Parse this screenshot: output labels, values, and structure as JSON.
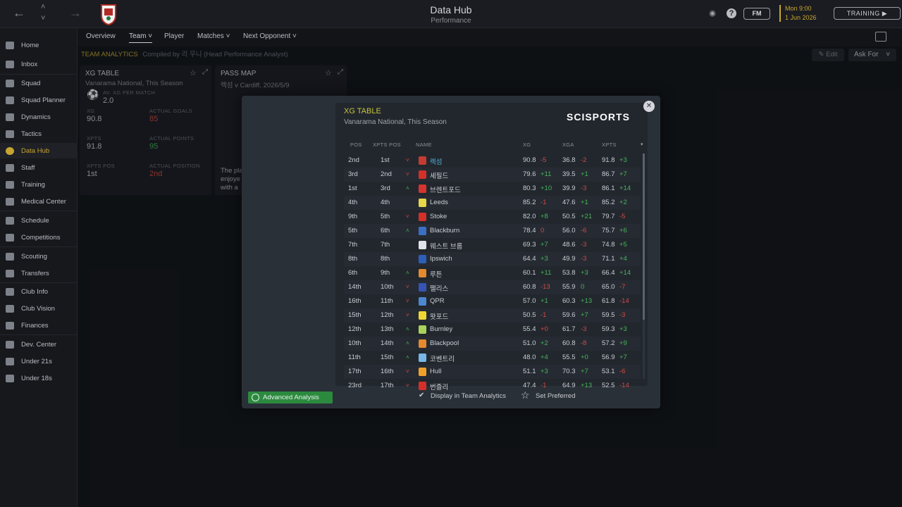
{
  "topbar": {
    "title": "Data Hub",
    "subtitle": "Performance",
    "fm_label": "FM",
    "date_line1": "Mon 9:00",
    "date_line2": "1 Jun 2026",
    "training_label": "TRAINING"
  },
  "sidebar": {
    "items": [
      {
        "label": "Home",
        "icon": "home-icon"
      },
      {
        "label": "Inbox",
        "icon": "inbox-icon"
      },
      {
        "label": "Squad",
        "icon": "shirt-icon"
      },
      {
        "label": "Squad Planner",
        "icon": "planner-icon"
      },
      {
        "label": "Dynamics",
        "icon": "dynamics-icon"
      },
      {
        "label": "Tactics",
        "icon": "tactics-icon"
      },
      {
        "label": "Data Hub",
        "icon": "data-hub-icon"
      },
      {
        "label": "Staff",
        "icon": "staff-icon"
      },
      {
        "label": "Training",
        "icon": "training-icon"
      },
      {
        "label": "Medical Center",
        "icon": "medical-icon"
      },
      {
        "label": "Schedule",
        "icon": "calendar-icon"
      },
      {
        "label": "Competitions",
        "icon": "trophy-icon"
      },
      {
        "label": "Scouting",
        "icon": "scouting-icon"
      },
      {
        "label": "Transfers",
        "icon": "transfers-icon"
      },
      {
        "label": "Club Info",
        "icon": "shield-icon"
      },
      {
        "label": "Club Vision",
        "icon": "vision-icon"
      },
      {
        "label": "Finances",
        "icon": "finances-icon"
      },
      {
        "label": "Dev. Center",
        "icon": "dev-center-icon"
      },
      {
        "label": "Under 21s",
        "icon": "under21-icon"
      },
      {
        "label": "Under 18s",
        "icon": "under18-icon"
      }
    ]
  },
  "subnav": {
    "tabs": [
      "Overview",
      "Team",
      "Player",
      "Matches",
      "Next Opponent"
    ]
  },
  "team_analytics": {
    "title": "TEAM ANALYTICS",
    "compiled_by": "Compiled by 리 무니 (Head Performance Analyst)",
    "edit_label": "Edit",
    "ask_for_label": "Ask For"
  },
  "xg_card": {
    "title": "XG TABLE",
    "subtitle": "Vanarama National, This Season",
    "av_label": "AV. XG PER MATCH",
    "av_value": "2.0",
    "xg_label": "XG",
    "xg_value": "90.8",
    "actual_goals_label": "ACTUAL GOALS",
    "actual_goals_value": "85",
    "xpts_label": "XPTS",
    "xpts_value": "91.8",
    "actual_points_label": "ACTUAL POINTS",
    "actual_points_value": "95",
    "xpts_pos_label": "XPTS POS",
    "xpts_pos_value": "1st",
    "actual_position_label": "ACTUAL POSITION",
    "actual_position_value": "2nd"
  },
  "pass_card": {
    "title": "PASS MAP",
    "subtitle": "렉섬 v Cardiff, 2026/5/9",
    "body_line1": "The pla",
    "body_line2": "enjoye",
    "body_line3": "with a"
  },
  "modal": {
    "title": "XG TABLE",
    "subtitle": "Vanarama National, This Season",
    "logo_text": "SCISPORTS",
    "headers": {
      "pos": "POS",
      "xpts_pos": "XPTS POS",
      "name": "NAME",
      "xg": "XG",
      "xga": "XGA",
      "xpts": "XPTS"
    },
    "rows": [
      {
        "pos": "2nd",
        "xpos": "1st",
        "dir": "down",
        "name": "렉섬",
        "xg": "90.8",
        "xg_d": "-5",
        "xga": "36.8",
        "xga_d": "-2",
        "xpts": "91.8",
        "xpts_d": "+3",
        "highlight": true,
        "color": "#c33b32"
      },
      {
        "pos": "3rd",
        "xpos": "2nd",
        "dir": "down",
        "name": "셰필드",
        "xg": "79.6",
        "xg_d": "+11",
        "xga": "39.5",
        "xga_d": "+1",
        "xpts": "86.7",
        "xpts_d": "+7",
        "color": "#d3302a"
      },
      {
        "pos": "1st",
        "xpos": "3rd",
        "dir": "up",
        "name": "브렌트포드",
        "xg": "80.3",
        "xg_d": "+10",
        "xga": "39.9",
        "xga_d": "-3",
        "xpts": "86.1",
        "xpts_d": "+14",
        "color": "#d5352e"
      },
      {
        "pos": "4th",
        "xpos": "4th",
        "dir": "none",
        "name": "Leeds",
        "xg": "85.2",
        "xg_d": "-1",
        "xga": "47.6",
        "xga_d": "+1",
        "xpts": "85.2",
        "xpts_d": "+2",
        "color": "#e7d64a"
      },
      {
        "pos": "9th",
        "xpos": "5th",
        "dir": "down",
        "name": "Stoke",
        "xg": "82.0",
        "xg_d": "+8",
        "xga": "50.5",
        "xga_d": "+21",
        "xpts": "79.7",
        "xpts_d": "-5",
        "color": "#d3302a"
      },
      {
        "pos": "5th",
        "xpos": "6th",
        "dir": "up",
        "name": "Blackburn",
        "xg": "78.4",
        "xg_d": "0",
        "xga": "56.0",
        "xga_d": "-6",
        "xpts": "75.7",
        "xpts_d": "+6",
        "color": "#3b6fc4"
      },
      {
        "pos": "7th",
        "xpos": "7th",
        "dir": "none",
        "name": "웨스트 브롬",
        "xg": "69.3",
        "xg_d": "+7",
        "xga": "48.6",
        "xga_d": "-3",
        "xpts": "74.8",
        "xpts_d": "+5",
        "color": "#e0e3e8"
      },
      {
        "pos": "8th",
        "xpos": "8th",
        "dir": "none",
        "name": "Ipswich",
        "xg": "64.4",
        "xg_d": "+3",
        "xga": "49.9",
        "xga_d": "-3",
        "xpts": "71.1",
        "xpts_d": "+4",
        "color": "#2d5fb8"
      },
      {
        "pos": "6th",
        "xpos": "9th",
        "dir": "up",
        "name": "루튼",
        "xg": "60.1",
        "xg_d": "+11",
        "xga": "53.8",
        "xga_d": "+3",
        "xpts": "66.4",
        "xpts_d": "+14",
        "color": "#e58a2d"
      },
      {
        "pos": "14th",
        "xpos": "10th",
        "dir": "down",
        "name": "팰리스",
        "xg": "60.8",
        "xg_d": "-13",
        "xga": "55.9",
        "xga_d": "0",
        "xpts": "65.0",
        "xpts_d": "-7",
        "color": "#3554b6"
      },
      {
        "pos": "16th",
        "xpos": "11th",
        "dir": "down",
        "name": "QPR",
        "xg": "57.0",
        "xg_d": "+1",
        "xga": "60.3",
        "xga_d": "+13",
        "xpts": "61.8",
        "xpts_d": "-14",
        "color": "#4d87d0"
      },
      {
        "pos": "15th",
        "xpos": "12th",
        "dir": "down",
        "name": "왓포드",
        "xg": "50.5",
        "xg_d": "-1",
        "xga": "59.6",
        "xga_d": "+7",
        "xpts": "59.5",
        "xpts_d": "-3",
        "color": "#f0d632"
      },
      {
        "pos": "12th",
        "xpos": "13th",
        "dir": "up",
        "name": "Burnley",
        "xg": "55.4",
        "xg_d": "+0",
        "xga": "61.7",
        "xga_d": "-3",
        "xpts": "59.3",
        "xpts_d": "+3",
        "color": "#a8d25a"
      },
      {
        "pos": "10th",
        "xpos": "14th",
        "dir": "up",
        "name": "Blackpool",
        "xg": "51.0",
        "xg_d": "+2",
        "xga": "60.8",
        "xga_d": "-8",
        "xpts": "57.2",
        "xpts_d": "+9",
        "color": "#e58a2d"
      },
      {
        "pos": "11th",
        "xpos": "15th",
        "dir": "up",
        "name": "코벤트리",
        "xg": "48.0",
        "xg_d": "+4",
        "xga": "55.5",
        "xga_d": "+0",
        "xpts": "56.9",
        "xpts_d": "+7",
        "color": "#79b6e6"
      },
      {
        "pos": "17th",
        "xpos": "16th",
        "dir": "down",
        "name": "Hull",
        "xg": "51.1",
        "xg_d": "+3",
        "xga": "70.3",
        "xga_d": "+7",
        "xpts": "53.1",
        "xpts_d": "-6",
        "color": "#f0a12a"
      },
      {
        "pos": "23rd",
        "xpos": "17th",
        "dir": "down",
        "name": "번즐리",
        "xg": "47.4",
        "xg_d": "-1",
        "xga": "64.9",
        "xga_d": "+13",
        "xpts": "52.5",
        "xpts_d": "-14",
        "color": "#d3302a"
      }
    ],
    "advanced_label": "Advanced Analysis",
    "display_label": "Display in Team Analytics",
    "preferred_label": "Set Preferred"
  }
}
